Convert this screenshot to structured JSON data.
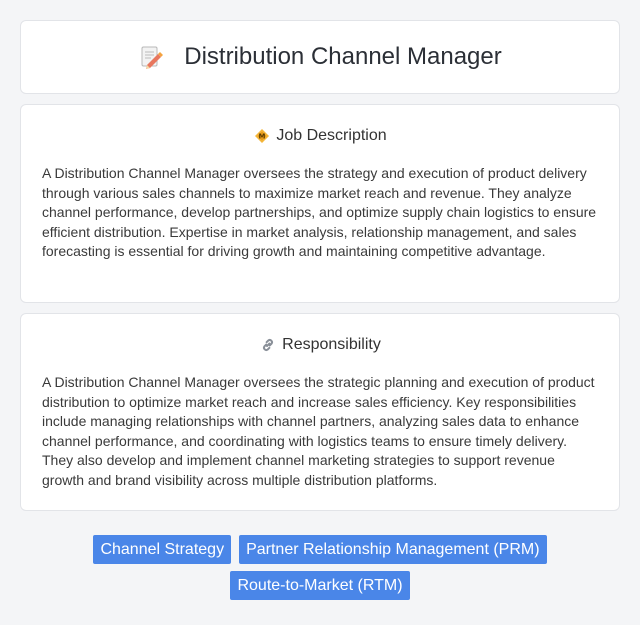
{
  "header": {
    "icon": "memo-pencil-icon",
    "title": "Distribution Channel Manager"
  },
  "job_description": {
    "icon": "diamond-badge-icon",
    "title": "Job Description",
    "text": "A Distribution Channel Manager oversees the strategy and execution of product delivery through various sales channels to maximize market reach and revenue. They analyze channel performance, develop partnerships, and optimize supply chain logistics to ensure efficient distribution. Expertise in market analysis, relationship management, and sales forecasting is essential for driving growth and maintaining competitive advantage."
  },
  "responsibility": {
    "icon": "link-icon",
    "title": "Responsibility",
    "text": "A Distribution Channel Manager oversees the strategic planning and execution of product distribution to optimize market reach and increase sales efficiency. Key responsibilities include managing relationships with channel partners, analyzing sales data to enhance channel performance, and coordinating with logistics teams to ensure timely delivery. They also develop and implement channel marketing strategies to support revenue growth and brand visibility across multiple distribution platforms."
  },
  "tags": [
    "Channel Strategy",
    "Partner Relationship Management (PRM)",
    "Route-to-Market (RTM)"
  ],
  "colors": {
    "tag_background": "#4a86e8",
    "page_background": "#f4f5f7"
  }
}
